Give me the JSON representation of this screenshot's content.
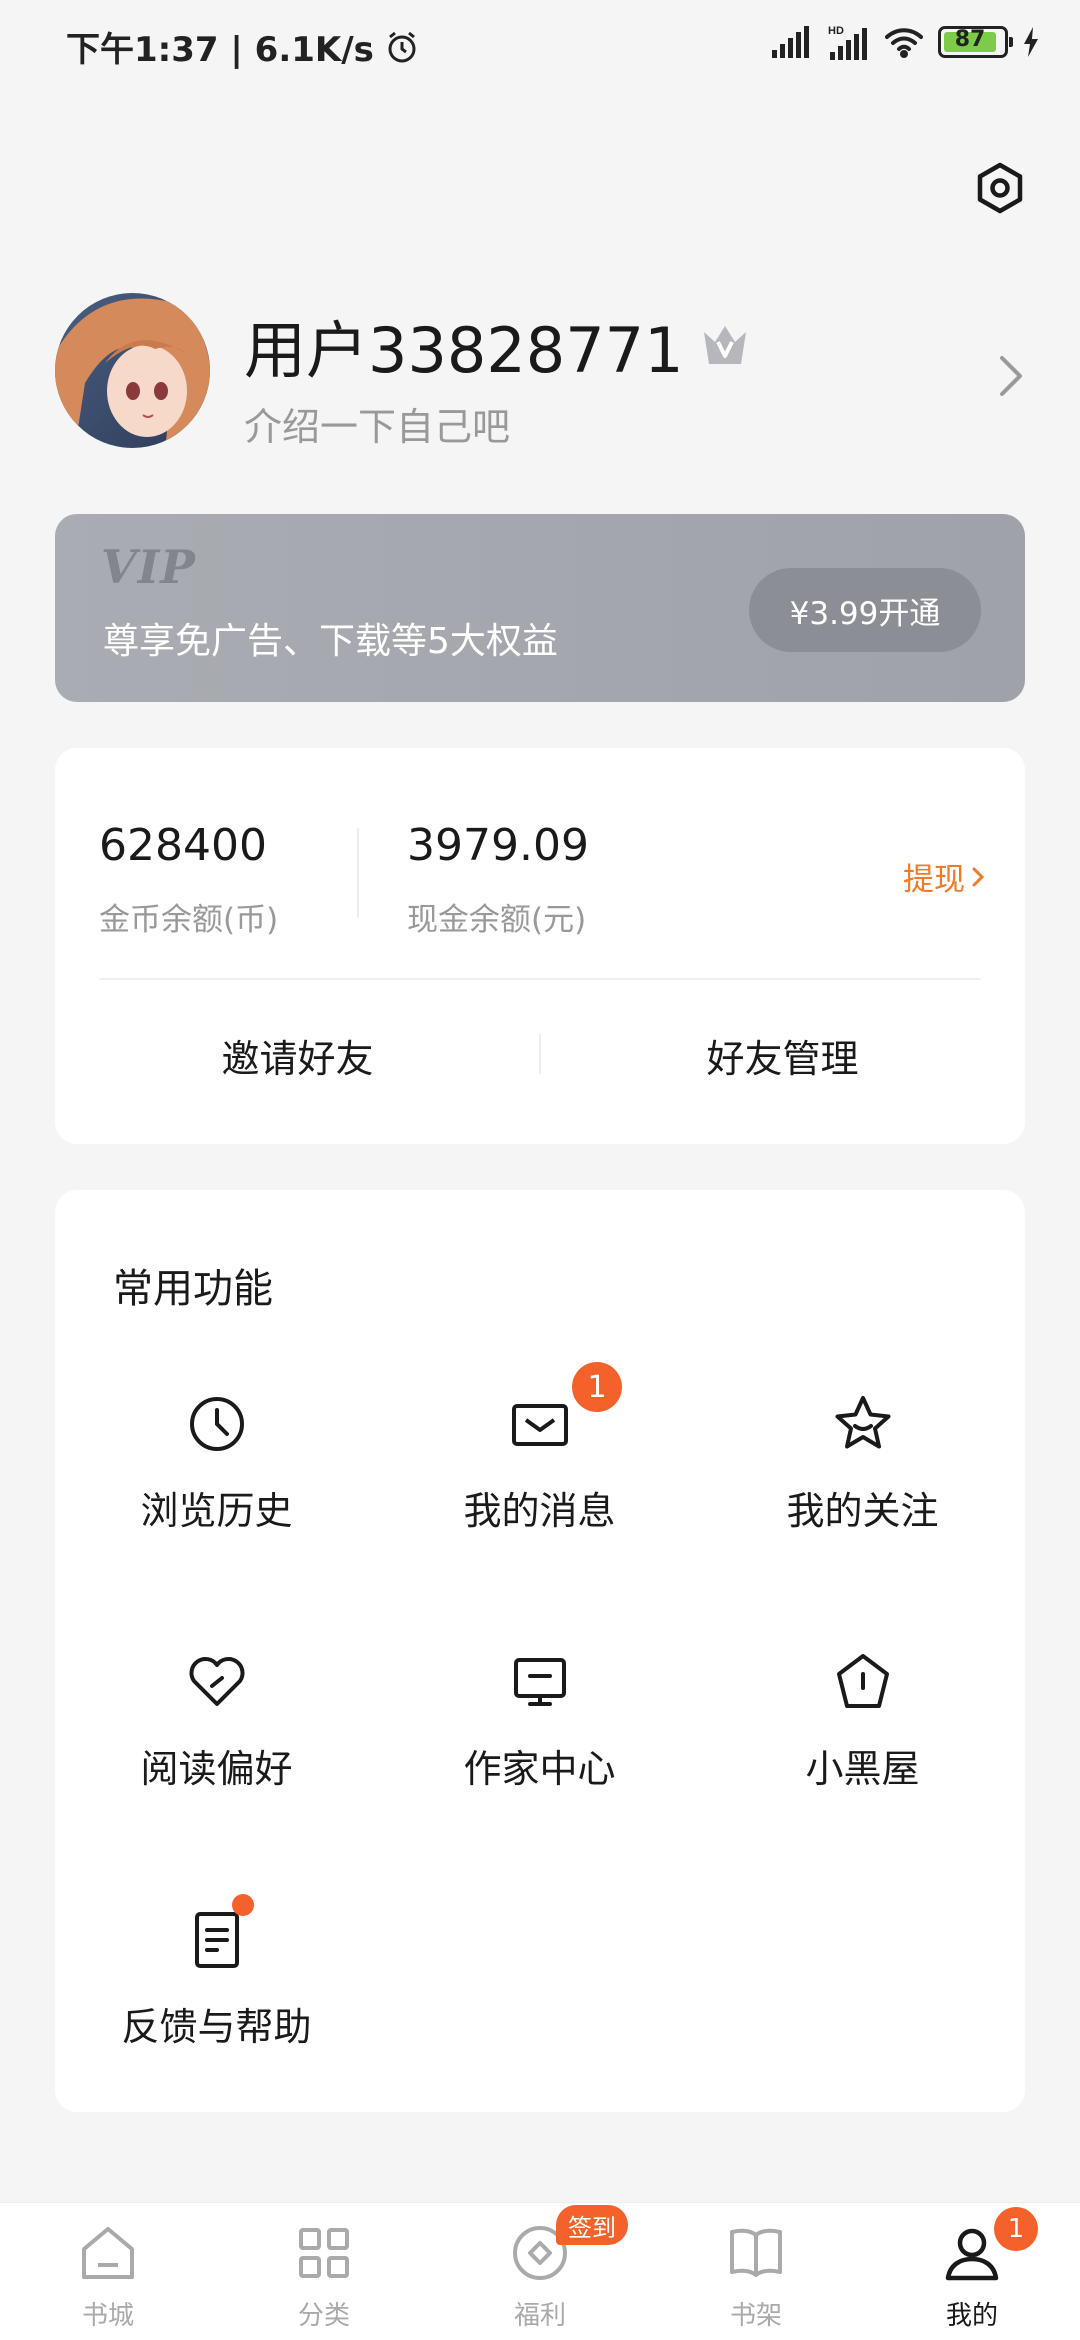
{
  "status_bar": {
    "time": "下午1:37 | 6.1K/s",
    "battery": "87",
    "hd": "HD"
  },
  "profile": {
    "username": "用户33828771",
    "intro": "介绍一下自己吧"
  },
  "vip": {
    "logo": "VIP",
    "desc": "尊享免广告、下载等5大权益",
    "button": "¥3.99开通"
  },
  "wallet": {
    "coin_value": "628400",
    "coin_label": "金币余额(币)",
    "cash_value": "3979.09",
    "cash_label": "现金余额(元)",
    "withdraw": "提现",
    "invite": "邀请好友",
    "friends": "好友管理"
  },
  "functions": {
    "title": "常用功能",
    "items": [
      {
        "label": "浏览历史",
        "icon": "clock-icon"
      },
      {
        "label": "我的消息",
        "icon": "message-icon",
        "badge": "1"
      },
      {
        "label": "我的关注",
        "icon": "star-icon"
      },
      {
        "label": "阅读偏好",
        "icon": "heart-check-icon"
      },
      {
        "label": "作家中心",
        "icon": "monitor-icon"
      },
      {
        "label": "小黑屋",
        "icon": "house-icon"
      },
      {
        "label": "反馈与帮助",
        "icon": "document-icon",
        "dot": true
      }
    ]
  },
  "bottom_nav": {
    "items": [
      {
        "label": "书城",
        "icon": "home-icon"
      },
      {
        "label": "分类",
        "icon": "grid-icon"
      },
      {
        "label": "福利",
        "icon": "coin-icon",
        "badge": "签到"
      },
      {
        "label": "书架",
        "icon": "book-icon"
      },
      {
        "label": "我的",
        "icon": "person-icon",
        "badge": "1",
        "active": true
      }
    ]
  },
  "colors": {
    "accent": "#f07a28",
    "badge": "#f4612b",
    "vip_card": "#a5a8ae"
  }
}
